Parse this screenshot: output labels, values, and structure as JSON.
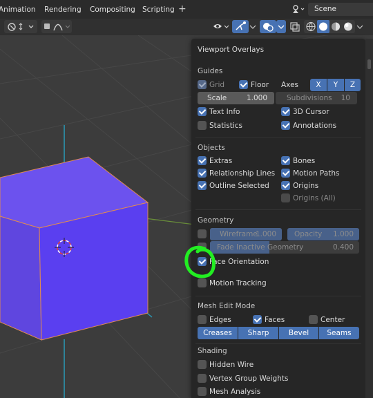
{
  "menu": {
    "items": [
      "Animation",
      "Rendering",
      "Compositing",
      "Scripting"
    ],
    "add_label": "+",
    "scene_label": "Scene"
  },
  "panel": {
    "title": "Viewport Overlays",
    "guides": {
      "section": "Guides",
      "grid": "Grid",
      "floor": "Floor",
      "axes": "Axes",
      "axis_x": "X",
      "axis_y": "Y",
      "axis_z": "Z",
      "scale_label": "Scale",
      "scale_value": "1.000",
      "subdivisions_label": "Subdivisions",
      "subdivisions_value": "10",
      "text_info": "Text Info",
      "cursor_3d": "3D Cursor",
      "statistics": "Statistics",
      "annotations": "Annotations"
    },
    "objects": {
      "section": "Objects",
      "extras": "Extras",
      "bones": "Bones",
      "relationship_lines": "Relationship Lines",
      "motion_paths": "Motion Paths",
      "outline_selected": "Outline Selected",
      "origins": "Origins",
      "origins_all": "Origins (All)"
    },
    "geometry": {
      "section": "Geometry",
      "wireframe_label": "Wireframe",
      "wireframe_value": "1.000",
      "opacity_label": "Opacity",
      "opacity_value": "1.000",
      "fade_label": "Fade Inactive Geometry",
      "fade_value": "0.400",
      "face_orientation": "Face Orientation",
      "motion_tracking": "Motion Tracking"
    },
    "mesh_edit": {
      "section": "Mesh Edit Mode",
      "edges": "Edges",
      "faces": "Faces",
      "center": "Center",
      "creases": "Creases",
      "sharp": "Sharp",
      "bevel": "Bevel",
      "seams": "Seams"
    },
    "shading": {
      "section": "Shading",
      "hidden_wire": "Hidden Wire",
      "vertex_group_weights": "Vertex Group Weights",
      "mesh_analysis": "Mesh Analysis"
    }
  },
  "colors": {
    "accent": "#4772b3",
    "cube_face": "#6a4ff0",
    "highlight_circle": "#22ee22"
  }
}
